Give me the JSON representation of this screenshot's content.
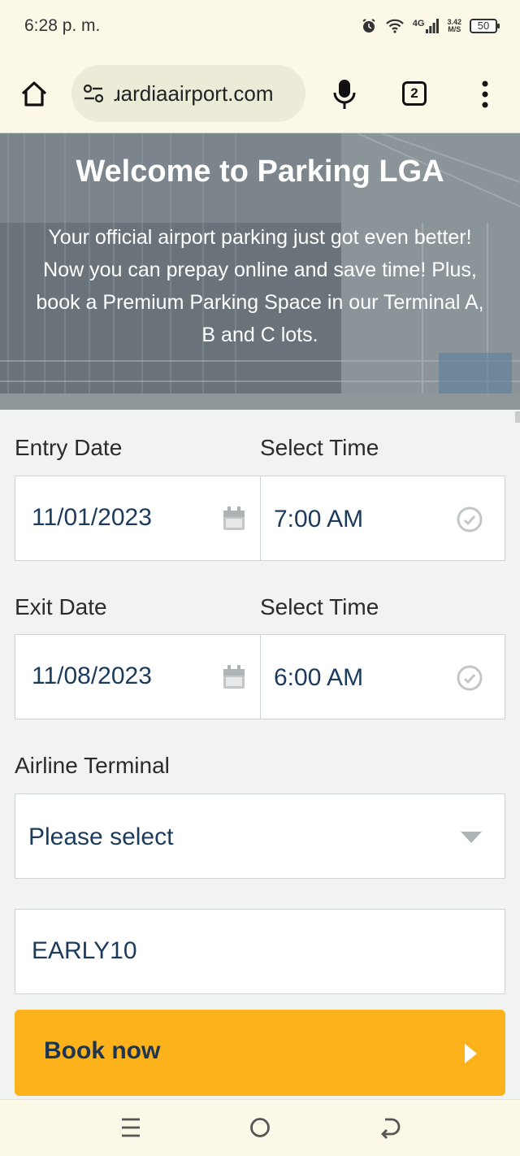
{
  "status_bar": {
    "time": "6:28 p. m.",
    "network": "4G",
    "speed_value": "3.42",
    "speed_unit": "M/S",
    "battery": "50"
  },
  "browser": {
    "url": "ɹardiaairport.com",
    "tab_count": "2",
    "icons": [
      "home-icon",
      "tune-icon",
      "mic-icon",
      "tabs-icon",
      "more-vert-icon"
    ]
  },
  "hero": {
    "title": "Welcome to Parking LGA",
    "text": "Your official airport parking just got even better! Now you can prepay online and save time! Plus, book a Premium Parking Space in our Terminal A, B and C lots."
  },
  "form": {
    "entry_date_label": "Entry Date",
    "entry_time_label": "Select Time",
    "entry_date_value": "11/01/2023",
    "entry_time_value": "7:00 AM",
    "exit_date_label": "Exit Date",
    "exit_time_label": "Select Time",
    "exit_date_value": "11/08/2023",
    "exit_time_value": "6:00 AM",
    "terminal_label": "Airline Terminal",
    "terminal_value": "Please select",
    "promo_value": "EARLY10",
    "book_label": "Book now"
  },
  "colors": {
    "accent": "#fcb21b",
    "text_value": "#1c3b5c",
    "chrome_bg": "#fbf8e8"
  }
}
